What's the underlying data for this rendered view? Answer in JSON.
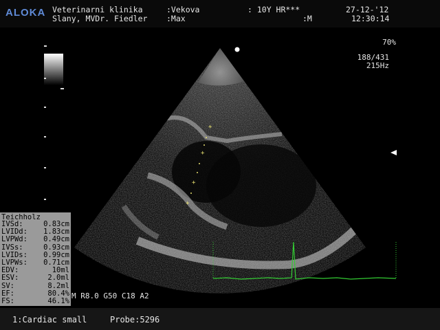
{
  "header": {
    "logo": "ALOKA",
    "clinic": "Veterinarni klinika",
    "owner": "Slany, MVDr. Fiedler",
    "patient1": ":Vekova",
    "patient2": ":Max",
    "age_hr": ": 10Y HR***",
    "sex": ":M",
    "date": "27-12-'12",
    "time": "12:30:14"
  },
  "status": {
    "gain_percent": "70%",
    "depth_frame": "188/431",
    "frequency": "215Hz"
  },
  "image_params": "M R8.0 G50 C18 A2",
  "measurements": {
    "title": "Teichholz",
    "rows": [
      {
        "label": "IVSd:",
        "value": "0.83cm"
      },
      {
        "label": "LVIDd:",
        "value": "1.83cm"
      },
      {
        "label": "LVPWd:",
        "value": "0.49cm"
      },
      {
        "label": "IVSs:",
        "value": "0.93cm"
      },
      {
        "label": "LVIDs:",
        "value": "0.99cm"
      },
      {
        "label": "LVPWs:",
        "value": "0.71cm"
      },
      {
        "label": "EDV:",
        "value": "10ml"
      },
      {
        "label": "ESV:",
        "value": "2.0ml"
      },
      {
        "label": "SV:",
        "value": "8.2ml"
      },
      {
        "label": "EF:",
        "value": "80.4%"
      },
      {
        "label": "FS:",
        "value": "46.1%"
      }
    ]
  },
  "footer": {
    "preset": "1:Cardiac small",
    "probe": "Probe:5296"
  },
  "colors": {
    "logo": "#5f8ad6",
    "ecg_trace": "#33cc33",
    "caliper": "#e8e070",
    "measurement_panel": "#9a9a9a"
  }
}
